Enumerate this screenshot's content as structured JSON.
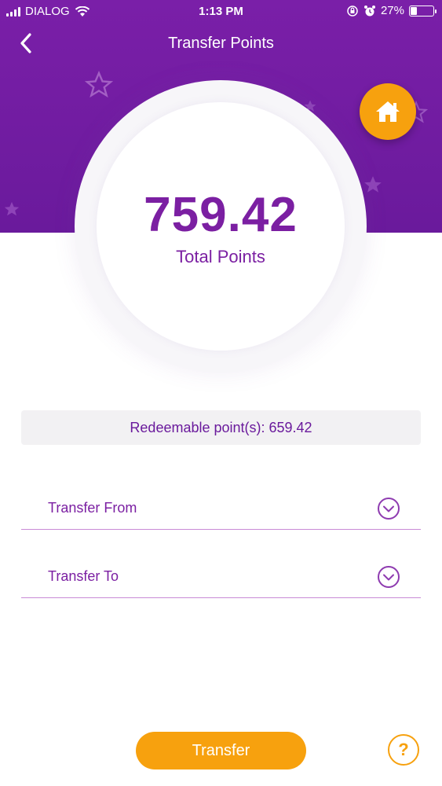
{
  "status_bar": {
    "carrier": "DIALOG",
    "time": "1:13 PM",
    "battery": "27%",
    "battery_level": 0.27,
    "icons": [
      "signal-icon",
      "wifi-icon",
      "lock-rotation-icon",
      "alarm-icon",
      "battery-icon"
    ]
  },
  "nav": {
    "title": "Transfer Points",
    "back_icon": "chevron-left-icon",
    "home_icon": "home-icon"
  },
  "points": {
    "value": "759.42",
    "label": "Total Points"
  },
  "redeemable": {
    "text": "Redeemable point(s): 659.42"
  },
  "form": {
    "transfer_from": {
      "label": "Transfer From",
      "icon": "chevron-down-icon"
    },
    "transfer_to": {
      "label": "Transfer To",
      "icon": "chevron-down-icon"
    }
  },
  "actions": {
    "transfer_label": "Transfer",
    "help_label": "?"
  },
  "colors": {
    "header": "#6a1a9c",
    "accent": "#7b1fa2",
    "orange": "#f7a10e",
    "divider": "#c98ad6"
  }
}
